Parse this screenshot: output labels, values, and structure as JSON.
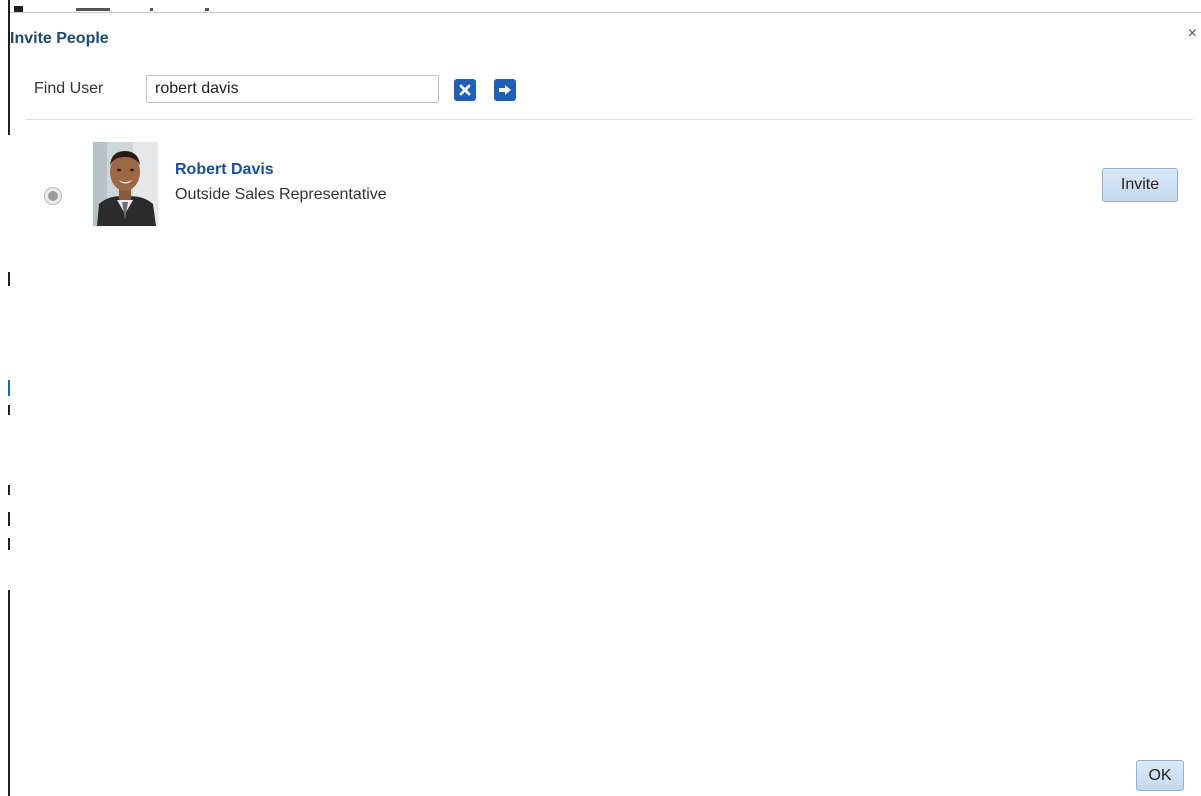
{
  "dialog": {
    "title": "Invite People",
    "close_glyph": "×"
  },
  "search": {
    "label": "Find User",
    "value": "robert davis",
    "clear_icon": "clear-icon",
    "go_icon": "arrow-right-icon"
  },
  "results": [
    {
      "name": "Robert Davis",
      "job_title": "Outside Sales Representative",
      "selected": true,
      "invite_label": "Invite"
    }
  ],
  "footer": {
    "ok_label": "OK"
  },
  "colors": {
    "title": "#1d4a6e",
    "link": "#1b4e9a",
    "icon_button": "#1f5fb4",
    "button_bg": "#c4d9ef"
  }
}
